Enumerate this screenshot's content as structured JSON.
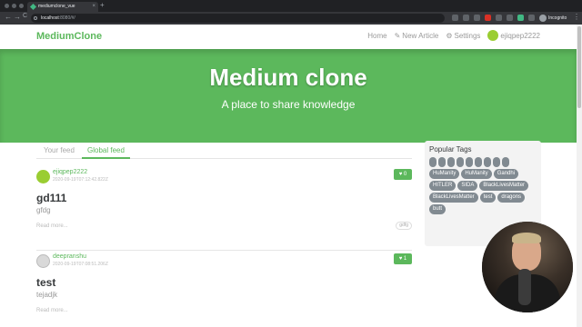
{
  "browser": {
    "tab_title": "mediumclone_vue",
    "tab_close": "×",
    "new_tab": "+",
    "back": "←",
    "forward": "→",
    "reload": "C",
    "url_host": "localhost",
    "url_port": ":8080/#/",
    "profile_label": "Incognito",
    "menu": "⋮"
  },
  "navbar": {
    "brand": "MediumClone",
    "home": "Home",
    "new_article_icon": "✎",
    "new_article": "New Article",
    "settings_icon": "⚙",
    "settings": "Settings",
    "username": "ejiqpep2222"
  },
  "banner": {
    "title": "Medium clone",
    "subtitle": "A place to share knowledge"
  },
  "feed": {
    "tabs": [
      "Your feed",
      "Global feed"
    ],
    "articles": [
      {
        "author": "ejiqpep2222",
        "date": "2020-09-19T07:12:42.822Z",
        "favorites": "♥ 0",
        "title": "gd111",
        "description": "gfdg",
        "read_more": "Read more...",
        "tag": "gdfg"
      },
      {
        "author": "deepranshu",
        "date": "2020-09-19T07:08:51.206Z",
        "favorites": "♥ 1",
        "title": "test",
        "description": "tejadjk",
        "read_more": "Read more..."
      }
    ]
  },
  "sidebar": {
    "title": "Popular Tags",
    "tags": [
      "",
      "",
      "",
      "",
      "",
      "",
      "",
      "",
      "",
      "HuManity",
      "HuManity",
      "Gandhi",
      "HITLER",
      "SIDA",
      "BlackLivesMatter",
      "BlackLivesMatter",
      "test",
      "dragons",
      "butt"
    ]
  },
  "colors": {
    "brand": "#5cb85c",
    "tag_bg": "#818a91"
  }
}
